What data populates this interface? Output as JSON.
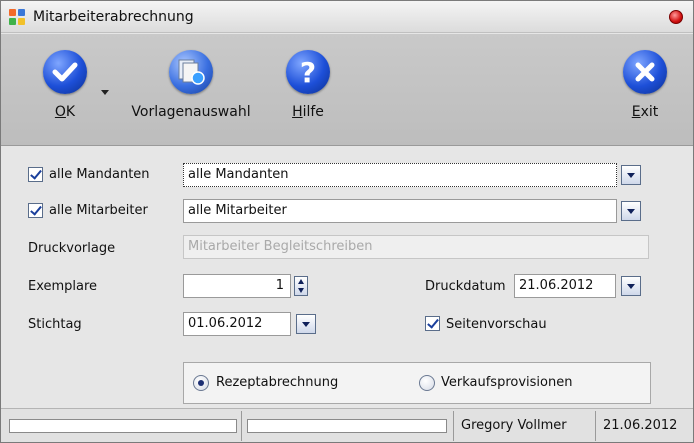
{
  "window": {
    "title": "Mitarbeiterabrechnung"
  },
  "toolbar": {
    "ok_label_u": "O",
    "ok_label_rest": "K",
    "template_label": "Vorlagenauswahl",
    "help_label_u": "H",
    "help_label_rest": "ilfe",
    "exit_label_u": "E",
    "exit_label_rest": "xit"
  },
  "form": {
    "mandanten_checkbox_label": "alle Mandanten",
    "mandanten_checked": true,
    "mandanten_value": "alle Mandanten",
    "mitarbeiter_checkbox_label": "alle Mitarbeiter",
    "mitarbeiter_checked": true,
    "mitarbeiter_value": "alle Mitarbeiter",
    "druckvorlage_label": "Druckvorlage",
    "druckvorlage_value": "Mitarbeiter Begleitschreiben",
    "exemplare_label": "Exemplare",
    "exemplare_value": "1",
    "druckdatum_label": "Druckdatum",
    "druckdatum_value": "21.06.2012",
    "stichtag_label": "Stichtag",
    "stichtag_value": "01.06.2012",
    "seitenvorschau_label": "Seitenvorschau",
    "seitenvorschau_checked": true,
    "radio_rezept_label": "Rezeptabrechnung",
    "radio_verkauf_label": "Verkaufsprovisionen",
    "selected_radio": "Rezeptabrechnung"
  },
  "statusbar": {
    "user": "Gregory Vollmer",
    "date": "21.06.2012"
  },
  "colors": {
    "toolbar_bg": "#c4c4c4",
    "icon_blue": "#1d4fd8",
    "close_red": "#d21010"
  }
}
